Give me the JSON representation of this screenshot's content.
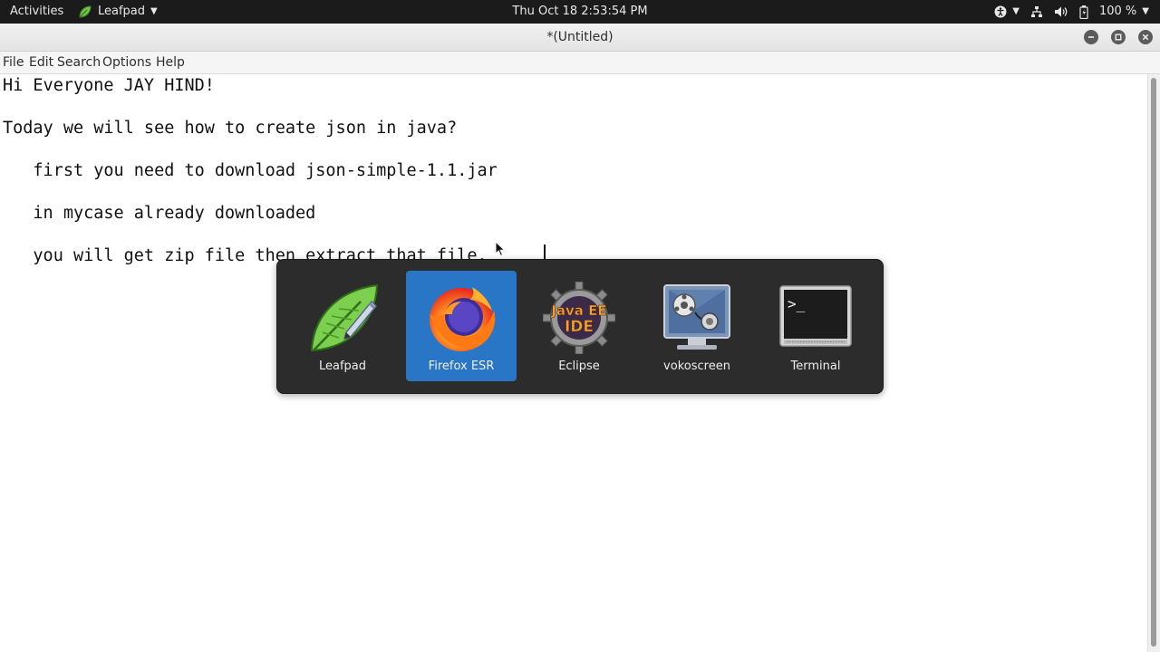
{
  "topbar": {
    "activities": "Activities",
    "app_name": "Leafpad",
    "clock": "Thu Oct 18   2:53:54 PM",
    "battery": "100 %"
  },
  "window": {
    "title": "*(Untitled)"
  },
  "menubar": {
    "items": [
      "File",
      "Edit",
      "Search",
      "Options",
      "Help"
    ]
  },
  "editor": {
    "lines": [
      "Hi Everyone JAY HIND!",
      "Today we will see how to create json in java?",
      "   first you need to download json-simple-1.1.jar",
      "   in mycase already downloaded",
      "   you will get zip file then extract that file. "
    ]
  },
  "switcher": {
    "apps": [
      {
        "label": "Leafpad",
        "icon": "leafpad-icon",
        "selected": false
      },
      {
        "label": "Firefox ESR",
        "icon": "firefox-icon",
        "selected": true
      },
      {
        "label": "Eclipse",
        "icon": "eclipse-icon",
        "selected": false
      },
      {
        "label": "vokoscreen",
        "icon": "vokoscreen-icon",
        "selected": false
      },
      {
        "label": "Terminal",
        "icon": "terminal-icon",
        "selected": false
      }
    ],
    "eclipse_icon_text": [
      "Java EE",
      "IDE"
    ],
    "terminal_prompt": ">_"
  },
  "colors": {
    "topbar_bg": "#1b1b1b",
    "selection": "#2a76c6",
    "switcher_bg": "#2c2c2c"
  }
}
